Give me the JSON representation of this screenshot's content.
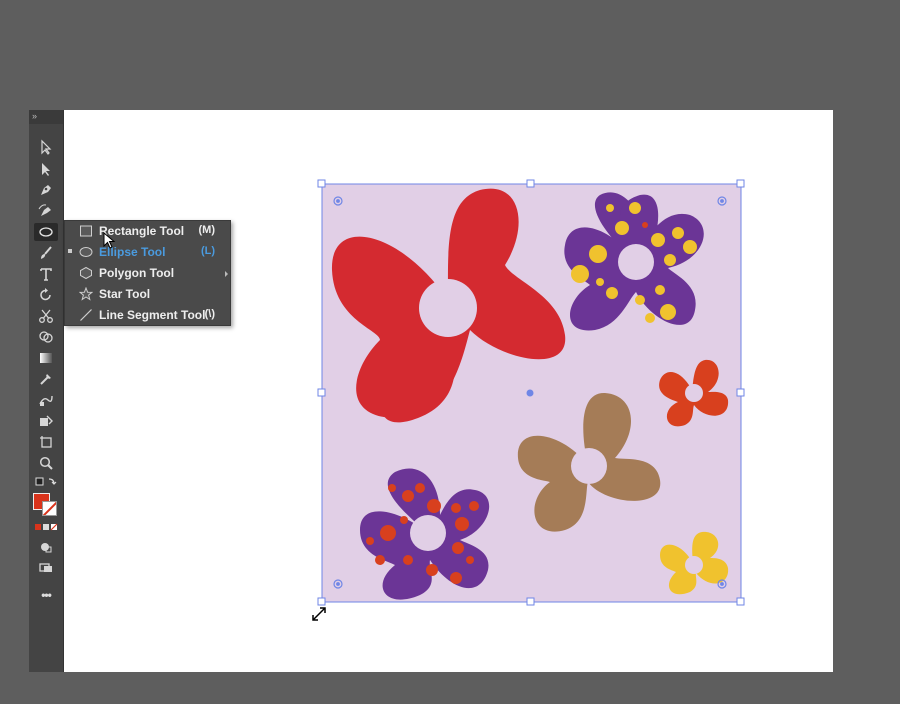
{
  "toolbar": {
    "tools": [
      {
        "name": "selection-tool",
        "icon": "arrow-icon"
      },
      {
        "name": "direct-selection-tool",
        "icon": "white-arrow-icon"
      },
      {
        "name": "pen-tool",
        "icon": "pen-icon"
      },
      {
        "name": "curvature-tool",
        "icon": "curvature-pen-icon"
      },
      {
        "name": "ellipse-tool",
        "icon": "ellipse-icon"
      },
      {
        "name": "paintbrush-tool",
        "icon": "brush-icon"
      },
      {
        "name": "type-tool",
        "icon": "type-icon"
      },
      {
        "name": "rotate-tool",
        "icon": "rotate-icon"
      },
      {
        "name": "scissors-tool",
        "icon": "scissors-icon"
      },
      {
        "name": "shape-builder-tool",
        "icon": "shape-builder-icon"
      },
      {
        "name": "gradient-tool",
        "icon": "gradient-icon"
      },
      {
        "name": "eyedropper-tool",
        "icon": "eyedropper-icon"
      },
      {
        "name": "blend-tool",
        "icon": "blend-icon"
      },
      {
        "name": "live-paint-tool",
        "icon": "live-paint-icon"
      },
      {
        "name": "artboard-tool",
        "icon": "artboard-icon"
      },
      {
        "name": "zoom-tool",
        "icon": "zoom-icon"
      }
    ],
    "fill_color": "#d9341c",
    "more_label": "•••"
  },
  "flyout": {
    "items": [
      {
        "label": "Rectangle Tool",
        "shortcut": "(M)",
        "icon": "rectangle-icon",
        "selected": false
      },
      {
        "label": "Ellipse Tool",
        "shortcut": "(L)",
        "icon": "ellipse-icon",
        "selected": true
      },
      {
        "label": "Polygon Tool",
        "shortcut": "",
        "icon": "polygon-icon",
        "selected": false
      },
      {
        "label": "Star Tool",
        "shortcut": "",
        "icon": "star-icon",
        "selected": false
      },
      {
        "label": "Line Segment Tool",
        "shortcut": "(\\)",
        "icon": "line-icon",
        "selected": false
      }
    ]
  },
  "artwork": {
    "background_color": "#e1cfe6",
    "selection_color": "#6f86e6",
    "flower_colors": {
      "red": "#d42a30",
      "purple": "#6b3596",
      "orange": "#d8401e",
      "brown": "#a57c57",
      "yellow": "#f0c22e",
      "dot_yellow": "#f0c22e",
      "dot_red": "#d8401e"
    }
  }
}
